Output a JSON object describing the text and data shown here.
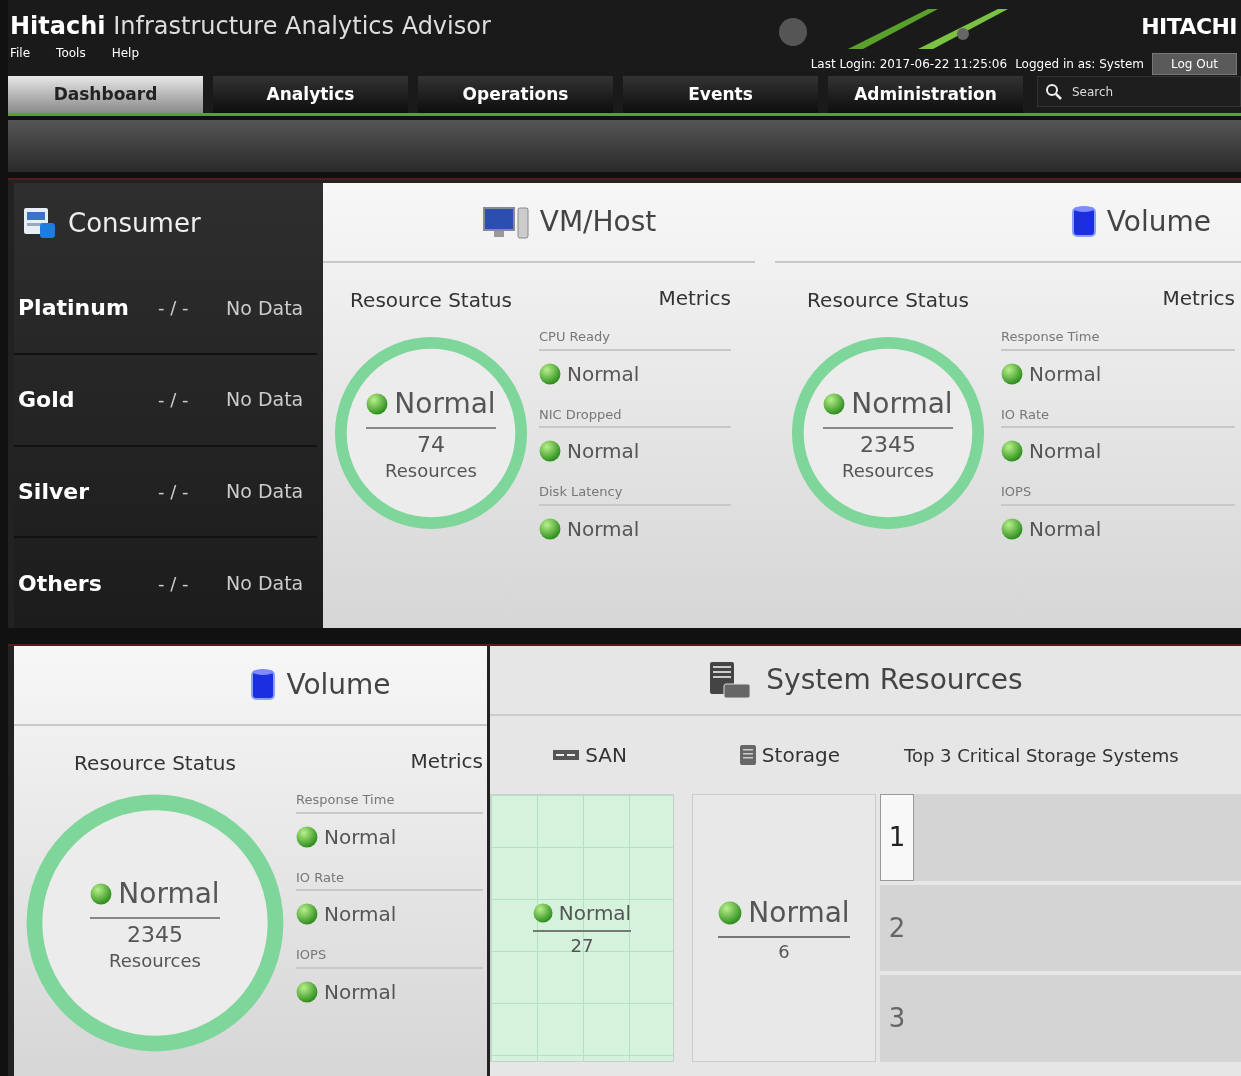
{
  "app": {
    "title_bold": "Hitachi",
    "title_rest": "Infrastructure Analytics Advisor",
    "brand": "HITACHI"
  },
  "menu": [
    "File",
    "Tools",
    "Help"
  ],
  "session": {
    "last_login": "Last Login: 2017-06-22 11:25:06",
    "logged_in": "Logged in as: System",
    "logout": "Log Out"
  },
  "tabs": [
    {
      "label": "Dashboard",
      "selected": true
    },
    {
      "label": "Analytics",
      "selected": false
    },
    {
      "label": "Operations",
      "selected": false
    },
    {
      "label": "Events",
      "selected": false
    },
    {
      "label": "Administration",
      "selected": false
    }
  ],
  "search": {
    "placeholder": "Search"
  },
  "consumer": {
    "title": "Consumer",
    "rows": [
      {
        "tier": "Platinum",
        "ratio": "- / -",
        "status": "No Data"
      },
      {
        "tier": "Gold",
        "ratio": "- / -",
        "status": "No Data"
      },
      {
        "tier": "Silver",
        "ratio": "- / -",
        "status": "No Data"
      },
      {
        "tier": "Others",
        "ratio": "- / -",
        "status": "No Data"
      }
    ]
  },
  "vm_host": {
    "title": "VM/Host",
    "resource_status_label": "Resource Status",
    "metrics_label": "Metrics",
    "summary": {
      "status": "Normal",
      "count": "74",
      "unit": "Resources"
    },
    "metrics": [
      {
        "name": "CPU Ready",
        "status": "Normal"
      },
      {
        "name": "NIC Dropped",
        "status": "Normal"
      },
      {
        "name": "Disk Latency",
        "status": "Normal"
      }
    ]
  },
  "volume_top": {
    "title": "Volume",
    "resource_status_label": "Resource Status",
    "metrics_label": "Metrics",
    "summary": {
      "status": "Normal",
      "count": "2345",
      "unit": "Resources"
    },
    "metrics": [
      {
        "name": "Response Time",
        "status": "Normal"
      },
      {
        "name": "IO Rate",
        "status": "Normal"
      },
      {
        "name": "IOPS",
        "status": "Normal"
      }
    ]
  },
  "volume_bottom": {
    "title": "Volume",
    "resource_status_label": "Resource Status",
    "metrics_label": "Metrics",
    "summary": {
      "status": "Normal",
      "count": "2345",
      "unit": "Resources"
    },
    "metrics": [
      {
        "name": "Response Time",
        "status": "Normal"
      },
      {
        "name": "IO Rate",
        "status": "Normal"
      },
      {
        "name": "IOPS",
        "status": "Normal"
      }
    ]
  },
  "system_resources": {
    "title": "System Resources",
    "san": {
      "label": "SAN",
      "status": "Normal",
      "count": "27"
    },
    "storage": {
      "label": "Storage",
      "status": "Normal",
      "count": "6"
    },
    "top3": {
      "title": "Top 3 Critical Storage Systems",
      "ranks": [
        {
          "rank": "1",
          "selected": true
        },
        {
          "rank": "2",
          "selected": false
        },
        {
          "rank": "3",
          "selected": false
        }
      ]
    }
  }
}
